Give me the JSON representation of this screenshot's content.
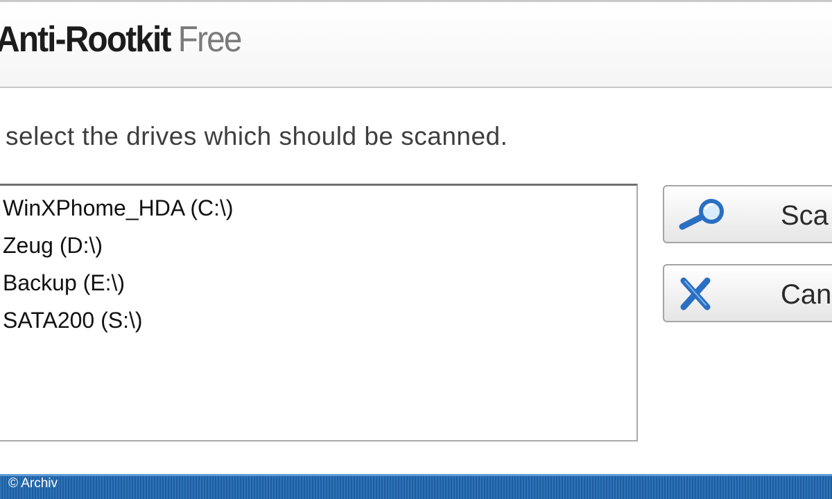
{
  "header": {
    "title_main": "Anti-Rootkit",
    "title_edition": "Free"
  },
  "instruction": "select the drives which should be scanned.",
  "drives": [
    {
      "label": "WinXPhome_HDA (C:\\)"
    },
    {
      "label": "Zeug (D:\\)"
    },
    {
      "label": "Backup (E:\\)"
    },
    {
      "label": "SATA200 (S:\\)"
    }
  ],
  "buttons": {
    "scan": {
      "label": "Sca",
      "icon": "magnifier-icon"
    },
    "cancel": {
      "label": "Canc",
      "icon": "close-x-icon"
    }
  },
  "footer": {
    "credit": "© Archiv"
  },
  "colors": {
    "footer_blue": "#2d73b8",
    "icon_blue": "#2a6fc2"
  }
}
